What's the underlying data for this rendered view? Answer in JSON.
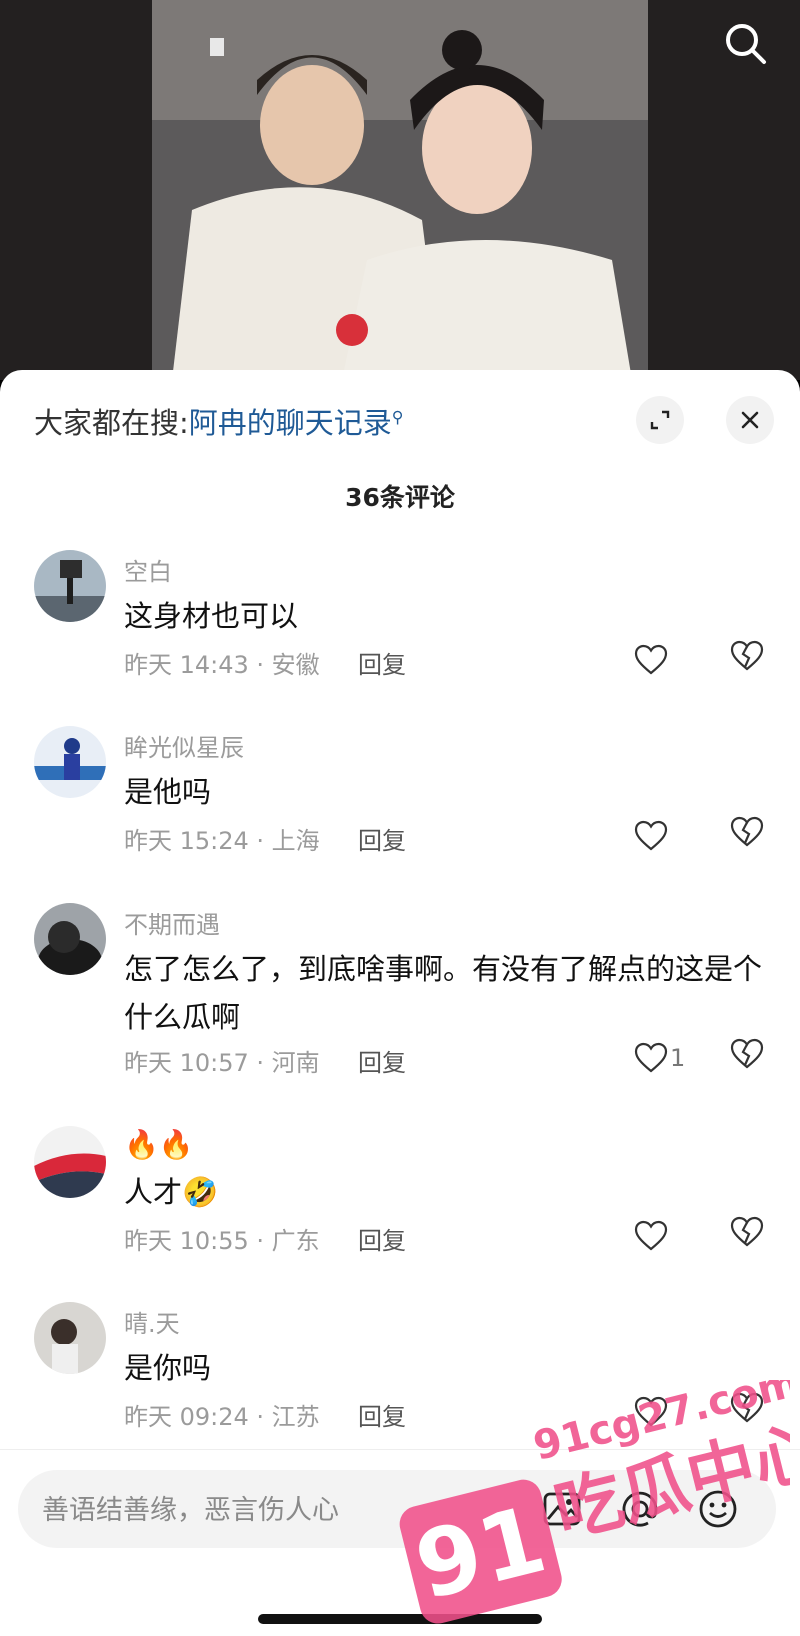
{
  "header": {
    "hot_search_prefix": "大家都在搜:",
    "hot_search_keyword": "阿冉的聊天记录"
  },
  "comment_count": "36条评论",
  "comments": [
    {
      "user": "空白",
      "text": "这身材也可以",
      "meta": "昨天 14:43 · 安徽",
      "reply": "回复",
      "likes": ""
    },
    {
      "user": "眸光似星辰",
      "text": "是他吗",
      "meta": "昨天 15:24 · 上海",
      "reply": "回复",
      "likes": ""
    },
    {
      "user": "不期而遇",
      "text": "怎了怎么了，到底啥事啊。有没有了解点的这是个什么瓜啊",
      "meta": "昨天 10:57 · 河南",
      "reply": "回复",
      "likes": "1"
    },
    {
      "user": "🔥🔥",
      "text": "人才🤣",
      "meta": "昨天 10:55 · 广东",
      "reply": "回复",
      "likes": ""
    },
    {
      "user": "晴.天",
      "text": "是你吗",
      "meta": "昨天 09:24 · 江苏",
      "reply": "回复",
      "likes": ""
    }
  ],
  "input": {
    "placeholder": "善语结善缘，恶言伤人心"
  },
  "watermark": {
    "number": "91",
    "site": "91cg27.com",
    "name": "吃瓜中心"
  },
  "colors": {
    "accent_link": "#1f5a96",
    "watermark_pink": "#f0508a"
  }
}
